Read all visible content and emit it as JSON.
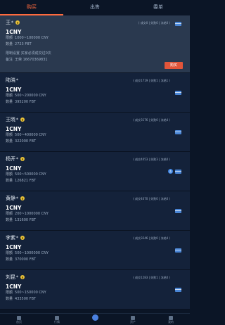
{
  "tabs": [
    {
      "label": "购买",
      "active": true
    },
    {
      "label": "出售",
      "active": false
    },
    {
      "label": "委单",
      "active": false
    }
  ],
  "cards": [
    {
      "name": "王",
      "stats": "( 成交0 | 失败0 | 冻结0 )",
      "price": "1CNY",
      "limit_label": "限额",
      "limit": "1000~100000 CNY",
      "qty_label": "数量",
      "qty": "2723 FBT",
      "expanded": true,
      "setting": "限制设置  买家必须成交过0次",
      "remark_label": "备注",
      "remark": "王荣  16670369831",
      "buy_label": "购买",
      "payments": [
        "bank-card"
      ]
    },
    {
      "name": "陆晓",
      "stats": "( 成交1719 | 失败1 | 冻结1 )",
      "price": "1CNY",
      "limit_label": "限额",
      "limit": "500~200000 CNY",
      "qty_label": "数量",
      "qty": "395200 FBT",
      "payments": [
        "bank-card"
      ]
    },
    {
      "name": "王晓",
      "stats": "( 成交3176 | 失败0 | 冻结4 )",
      "price": "1CNY",
      "limit_label": "限额",
      "limit": "500~400000 CNY",
      "qty_label": "数量",
      "qty": "322000 FBT",
      "payments": [
        "bank-card"
      ]
    },
    {
      "name": "杨开",
      "stats": "( 成交4053 | 失败3 | 冻结0 )",
      "price": "1CNY",
      "limit_label": "限额",
      "limit": "500~500000 CNY",
      "qty_label": "数量",
      "qty": "126821 FBT",
      "payments": [
        "alipay",
        "bank-card"
      ]
    },
    {
      "name": "黄静",
      "stats": "( 成交4070 | 失败0 | 冻结0 )",
      "price": "1CNY",
      "limit_label": "限额",
      "limit": "200~1000000 CNY",
      "qty_label": "数量",
      "qty": "131600 FBT",
      "payments": [
        "bank-card"
      ]
    },
    {
      "name": "李紫",
      "stats": "( 成交3246 | 失败0 | 冻结4 )",
      "price": "1CNY",
      "limit_label": "限额",
      "limit": "500~1000000 CNY",
      "qty_label": "数量",
      "qty": "370000 FBT",
      "payments": [
        "bank-card"
      ]
    },
    {
      "name": "刘昆",
      "stats": "( 成交1283 | 失败1 | 冻结0 )",
      "price": "1CNY",
      "limit_label": "限额",
      "limit": "500~150000 CNY",
      "qty_label": "数量",
      "qty": "433500 FBT",
      "payments": [
        "bank-card"
      ]
    }
  ],
  "bottom_nav": [
    {
      "label": "首页",
      "icon": "home-icon"
    },
    {
      "label": "行情",
      "icon": "market-icon"
    },
    {
      "label": "",
      "icon": "trade-icon"
    },
    {
      "label": "资产",
      "icon": "assets-icon"
    },
    {
      "label": "我的",
      "icon": "profile-icon"
    }
  ],
  "colors": {
    "accent": "#ff6a3d",
    "buy_button": "#e2553a",
    "bank": "#4a86d6",
    "card": "#14223a",
    "card_expanded": "#2a394f"
  }
}
